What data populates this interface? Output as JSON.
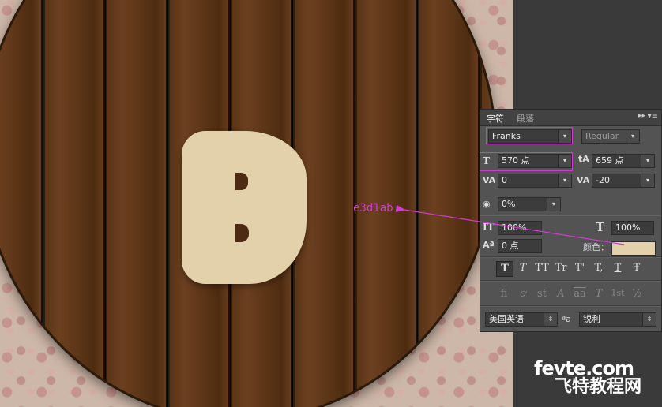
{
  "panel": {
    "tabs": [
      "字符",
      "段落"
    ],
    "font_family": "Franks",
    "font_style": "Regular",
    "font_size": "570 点",
    "leading": "659 点",
    "kerning": "0",
    "tracking": "-20",
    "tsume": "0%",
    "vertical_scale": "100%",
    "horizontal_scale": "100%",
    "baseline_shift": "0 点",
    "color_label": "颜色：",
    "color_hex": "#e3d1ab",
    "style_buttons": [
      "T",
      "T",
      "TT",
      "Tr",
      "T'",
      "T,",
      "T",
      "Ŧ"
    ],
    "opentype_buttons": [
      "fi",
      "ơ",
      "st",
      "A",
      "aa",
      "T",
      "1st",
      "½"
    ],
    "language": "美国英语",
    "aa_label": "ªa",
    "antialias": "锐利",
    "menu_icon": "▾≡",
    "collapse_icon": "▸▸"
  },
  "annotation": "e3d1ab",
  "letter": "B",
  "watermark": {
    "line1": "fevte.com",
    "line2": "飞特教程网"
  }
}
